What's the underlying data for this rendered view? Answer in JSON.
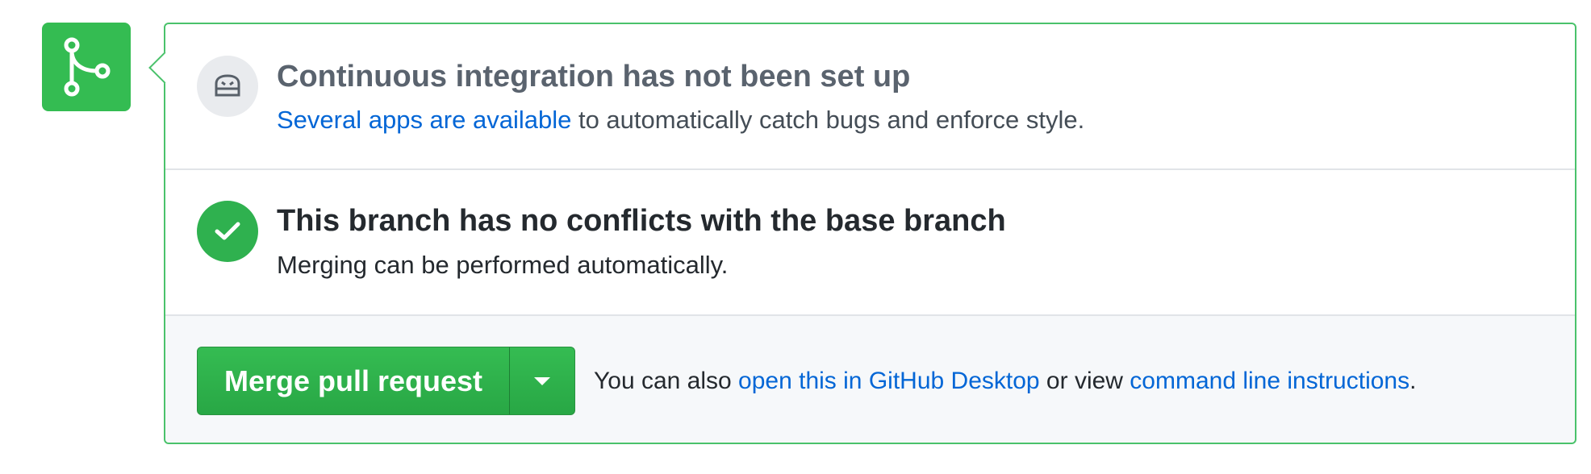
{
  "timeline": {
    "icon": "git-merge-icon"
  },
  "ci": {
    "icon": "robot-icon",
    "title": "Continuous integration has not been set up",
    "link": "Several apps are available",
    "text": " to automatically catch bugs and enforce style."
  },
  "conflicts": {
    "icon": "check-icon",
    "title": "This branch has no conflicts with the base branch",
    "text": "Merging can be performed automatically."
  },
  "merge": {
    "button_label": "Merge pull request",
    "dropdown_icon": "triangle-down-icon",
    "note_prefix": "You can also ",
    "desktop_link": "open this in GitHub Desktop",
    "note_middle": " or view ",
    "cli_link": "command line instructions",
    "note_suffix": "."
  },
  "colors": {
    "success": "#2fb14f",
    "border": "#4ac26b",
    "link": "#0366d6"
  }
}
